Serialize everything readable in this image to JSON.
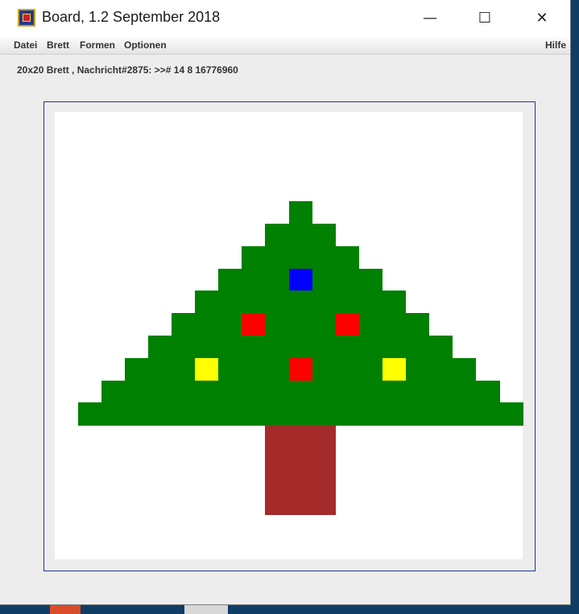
{
  "window": {
    "title": "Board, 1.2 September 2018",
    "controls": {
      "minimize": "—",
      "maximize": "☐",
      "close": "✕"
    }
  },
  "menu": {
    "left": [
      "Datei",
      "Brett",
      "Formen",
      "Optionen"
    ],
    "right": "Hilfe"
  },
  "status": {
    "text": "20x20 Brett , Nachricht#2875: >># 14 8 16776960"
  },
  "board": {
    "size": 20,
    "background": "#ffffff",
    "colors": {
      "green": "#008000",
      "brown": "#a52a2a",
      "red": "#ff0000",
      "yellow": "#ffff00",
      "blue": "#0000ff"
    },
    "tree_rows": [
      {
        "row": 4,
        "from": 10,
        "to": 10
      },
      {
        "row": 5,
        "from": 9,
        "to": 11
      },
      {
        "row": 6,
        "from": 8,
        "to": 12
      },
      {
        "row": 7,
        "from": 7,
        "to": 13
      },
      {
        "row": 8,
        "from": 6,
        "to": 14
      },
      {
        "row": 9,
        "from": 5,
        "to": 15
      },
      {
        "row": 10,
        "from": 4,
        "to": 16
      },
      {
        "row": 11,
        "from": 3,
        "to": 17
      },
      {
        "row": 12,
        "from": 2,
        "to": 18
      },
      {
        "row": 13,
        "from": 1,
        "to": 19
      }
    ],
    "trunk": {
      "rows": [
        14,
        15,
        16,
        17
      ],
      "from": 9,
      "to": 11
    },
    "ornaments": [
      {
        "row": 7,
        "col": 10,
        "color": "blue"
      },
      {
        "row": 9,
        "col": 8,
        "color": "red"
      },
      {
        "row": 9,
        "col": 12,
        "color": "red"
      },
      {
        "row": 11,
        "col": 6,
        "color": "yellow"
      },
      {
        "row": 11,
        "col": 10,
        "color": "red"
      },
      {
        "row": 11,
        "col": 14,
        "color": "yellow"
      }
    ]
  }
}
